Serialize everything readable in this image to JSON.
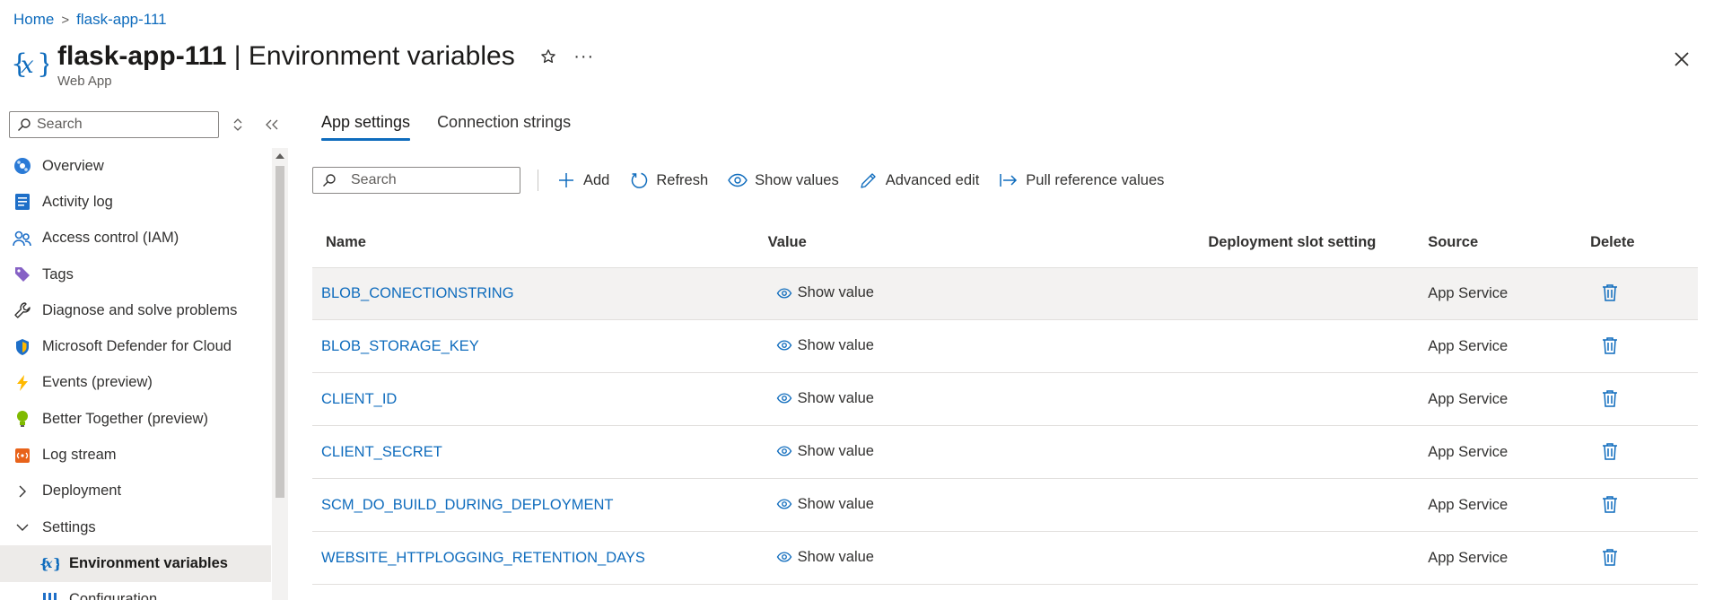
{
  "breadcrumb": {
    "home": "Home",
    "separator": ">",
    "current": "flask-app-111"
  },
  "header": {
    "resource_name": "flask-app-111",
    "divider": " | ",
    "page_name": "Environment variables",
    "subtitle": "Web App",
    "more": "···"
  },
  "sidebar": {
    "search_placeholder": "Search",
    "items": [
      {
        "label": "Overview",
        "icon": "globe-icon"
      },
      {
        "label": "Activity log",
        "icon": "activity-log-icon"
      },
      {
        "label": "Access control (IAM)",
        "icon": "people-icon"
      },
      {
        "label": "Tags",
        "icon": "tag-icon"
      },
      {
        "label": "Diagnose and solve problems",
        "icon": "wrench-icon"
      },
      {
        "label": "Microsoft Defender for Cloud",
        "icon": "shield-icon"
      },
      {
        "label": "Events (preview)",
        "icon": "lightning-icon"
      },
      {
        "label": "Better Together (preview)",
        "icon": "lightbulb-icon"
      },
      {
        "label": "Log stream",
        "icon": "log-stream-icon"
      },
      {
        "label": "Deployment",
        "icon": "chevron-right-icon"
      },
      {
        "label": "Settings",
        "icon": "chevron-down-icon"
      },
      {
        "label": "Environment variables",
        "icon": "variable-icon",
        "active": true
      },
      {
        "label": "Configuration",
        "icon": "configuration-icon"
      }
    ]
  },
  "tabs": [
    {
      "label": "App settings",
      "active": true
    },
    {
      "label": "Connection strings",
      "active": false
    }
  ],
  "toolbar": {
    "search_placeholder": "Search",
    "add": "Add",
    "refresh": "Refresh",
    "show_values": "Show values",
    "advanced_edit": "Advanced edit",
    "pull_reference": "Pull reference values"
  },
  "table": {
    "columns": {
      "name": "Name",
      "value": "Value",
      "slot": "Deployment slot setting",
      "source": "Source",
      "delete": "Delete"
    },
    "rows": [
      {
        "name": "BLOB_CONECTIONSTRING",
        "value": "Show value",
        "slot": "",
        "source": "App Service"
      },
      {
        "name": "BLOB_STORAGE_KEY",
        "value": "Show value",
        "slot": "",
        "source": "App Service"
      },
      {
        "name": "CLIENT_ID",
        "value": "Show value",
        "slot": "",
        "source": "App Service"
      },
      {
        "name": "CLIENT_SECRET",
        "value": "Show value",
        "slot": "",
        "source": "App Service"
      },
      {
        "name": "SCM_DO_BUILD_DURING_DEPLOYMENT",
        "value": "Show value",
        "slot": "",
        "source": "App Service"
      },
      {
        "name": "WEBSITE_HTTPLOGGING_RETENTION_DAYS",
        "value": "Show value",
        "slot": "",
        "source": "App Service"
      }
    ]
  },
  "colors": {
    "accent": "#0f6cbd",
    "active_row": "#f3f2f1",
    "active_nav": "#edebe9"
  }
}
